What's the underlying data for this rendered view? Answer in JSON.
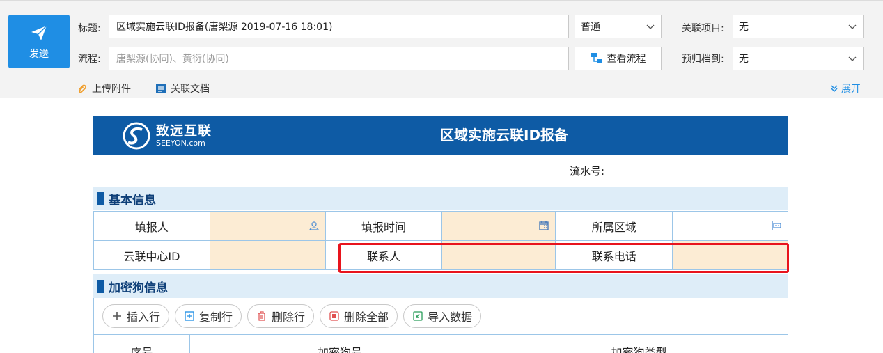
{
  "compose": {
    "send_label": "发送",
    "subject_label": "标题:",
    "subject_value": "区域实施云联ID报备(唐梨源 2019-07-16 18:01)",
    "priority_value": "普通",
    "related_project_label": "关联项目:",
    "related_project_value": "无",
    "flow_label": "流程:",
    "flow_placeholder": "唐梨源(协同)、黄衍(协同)",
    "view_flow_label": "查看流程",
    "archive_label": "预归档到:",
    "archive_value": "无",
    "upload_label": "上传附件",
    "related_doc_label": "关联文档",
    "expand_label": "展开"
  },
  "form": {
    "logo_cn": "致远互联",
    "logo_en": "SEEYON.com",
    "title": "区域实施云联ID报备",
    "serial_label": "流水号:",
    "basic_section": "基本信息",
    "reporter_label": "填报人",
    "report_time_label": "填报时间",
    "region_label": "所属区域",
    "center_id_label": "云联中心ID",
    "contact_label": "联系人",
    "phone_label": "联系电话",
    "dongle_section": "加密狗信息",
    "actions": {
      "insert_row": "插入行",
      "copy_row": "复制行",
      "delete_row": "删除行",
      "delete_all": "删除全部",
      "import_data": "导入数据"
    },
    "grid_headers": [
      "序号",
      "加密狗号",
      "加密狗类型"
    ]
  },
  "colors": {
    "accent": "#1f8ee4",
    "header_blue": "#0e5ba5",
    "input_fill": "#fcecd4",
    "highlight": "#e8141d"
  }
}
